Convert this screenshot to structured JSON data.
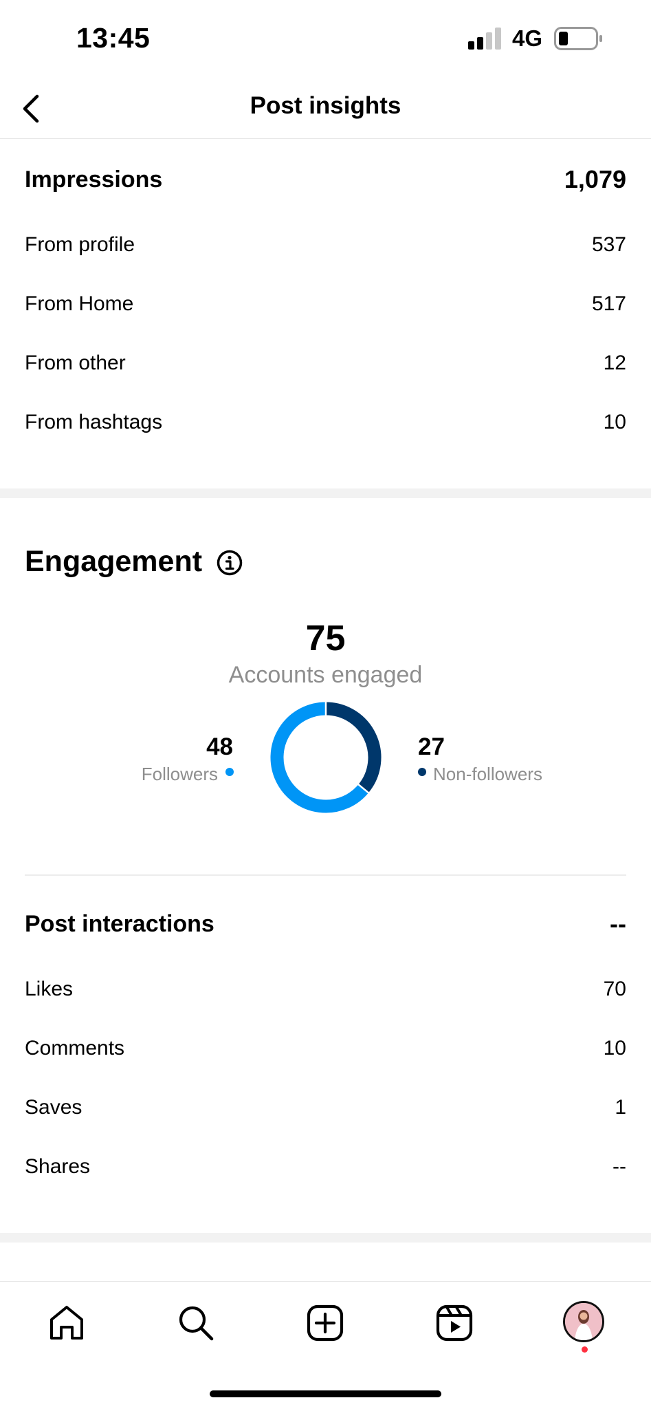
{
  "status_bar": {
    "time": "13:45",
    "network": "4G",
    "signal_icon": "signal-bars-icon",
    "battery_icon": "battery-low-icon"
  },
  "header": {
    "title": "Post insights",
    "back_icon": "chevron-left-icon"
  },
  "impressions": {
    "label": "Impressions",
    "total": "1,079",
    "items": [
      {
        "label": "From profile",
        "value": "537"
      },
      {
        "label": "From Home",
        "value": "517"
      },
      {
        "label": "From other",
        "value": "12"
      },
      {
        "label": "From hashtags",
        "value": "10"
      }
    ]
  },
  "engagement": {
    "title": "Engagement",
    "info_icon": "info-circle-icon",
    "accounts_engaged": "75",
    "accounts_engaged_label": "Accounts engaged",
    "followers": {
      "count": "48",
      "label": "Followers",
      "color": "#0095f6"
    },
    "non_followers": {
      "count": "27",
      "label": "Non-followers",
      "color": "#00376b"
    }
  },
  "chart_data": {
    "type": "pie",
    "categories": [
      "Followers",
      "Non-followers"
    ],
    "values": [
      48,
      27
    ],
    "colors": [
      "#0095f6",
      "#00376b"
    ],
    "title": "Accounts engaged"
  },
  "post_interactions": {
    "label": "Post interactions",
    "total": "--",
    "items": [
      {
        "label": "Likes",
        "value": "70"
      },
      {
        "label": "Comments",
        "value": "10"
      },
      {
        "label": "Saves",
        "value": "1"
      },
      {
        "label": "Shares",
        "value": "--"
      }
    ]
  },
  "tab_bar": {
    "items": [
      {
        "icon": "home-icon"
      },
      {
        "icon": "search-icon"
      },
      {
        "icon": "create-post-icon"
      },
      {
        "icon": "reels-icon"
      },
      {
        "icon": "profile-avatar"
      }
    ]
  }
}
